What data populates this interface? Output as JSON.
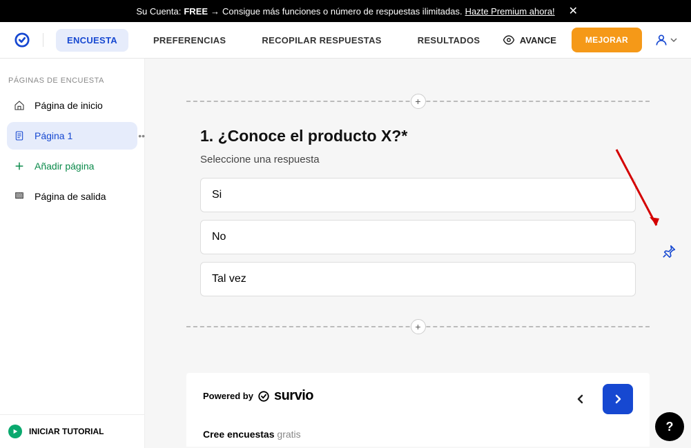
{
  "topbar": {
    "prefix": "Su Cuenta:",
    "free": "FREE",
    "arrow": "→",
    "text": "Consigue más funciones o número de respuestas ilimitadas.",
    "cta": "Hazte Premium ahora!",
    "close": "✕"
  },
  "nav": {
    "tabs": [
      "ENCUESTA",
      "PREFERENCIAS",
      "RECOPILAR RESPUESTAS",
      "RESULTADOS"
    ],
    "avance": "AVANCE",
    "mejorar": "MEJORAR"
  },
  "sidebar": {
    "title": "PÁGINAS DE ENCUESTA",
    "items": [
      {
        "label": "Página de inicio",
        "icon": "home"
      },
      {
        "label": "Página 1",
        "icon": "page",
        "active": true
      },
      {
        "label": "Añadir página",
        "icon": "plus",
        "green": true
      },
      {
        "label": "Página de salida",
        "icon": "exit"
      }
    ],
    "tutorial": "INICIAR TUTORIAL"
  },
  "question": {
    "title": "1. ¿Conoce el producto X?*",
    "subtitle": "Seleccione una respuesta",
    "options": [
      "Si",
      "No",
      "Tal vez"
    ]
  },
  "footer": {
    "powered": "Powered by",
    "brand": "survio",
    "text_bold": "Cree encuestas",
    "text_light": " gratis"
  },
  "help": "?",
  "plus": "+"
}
